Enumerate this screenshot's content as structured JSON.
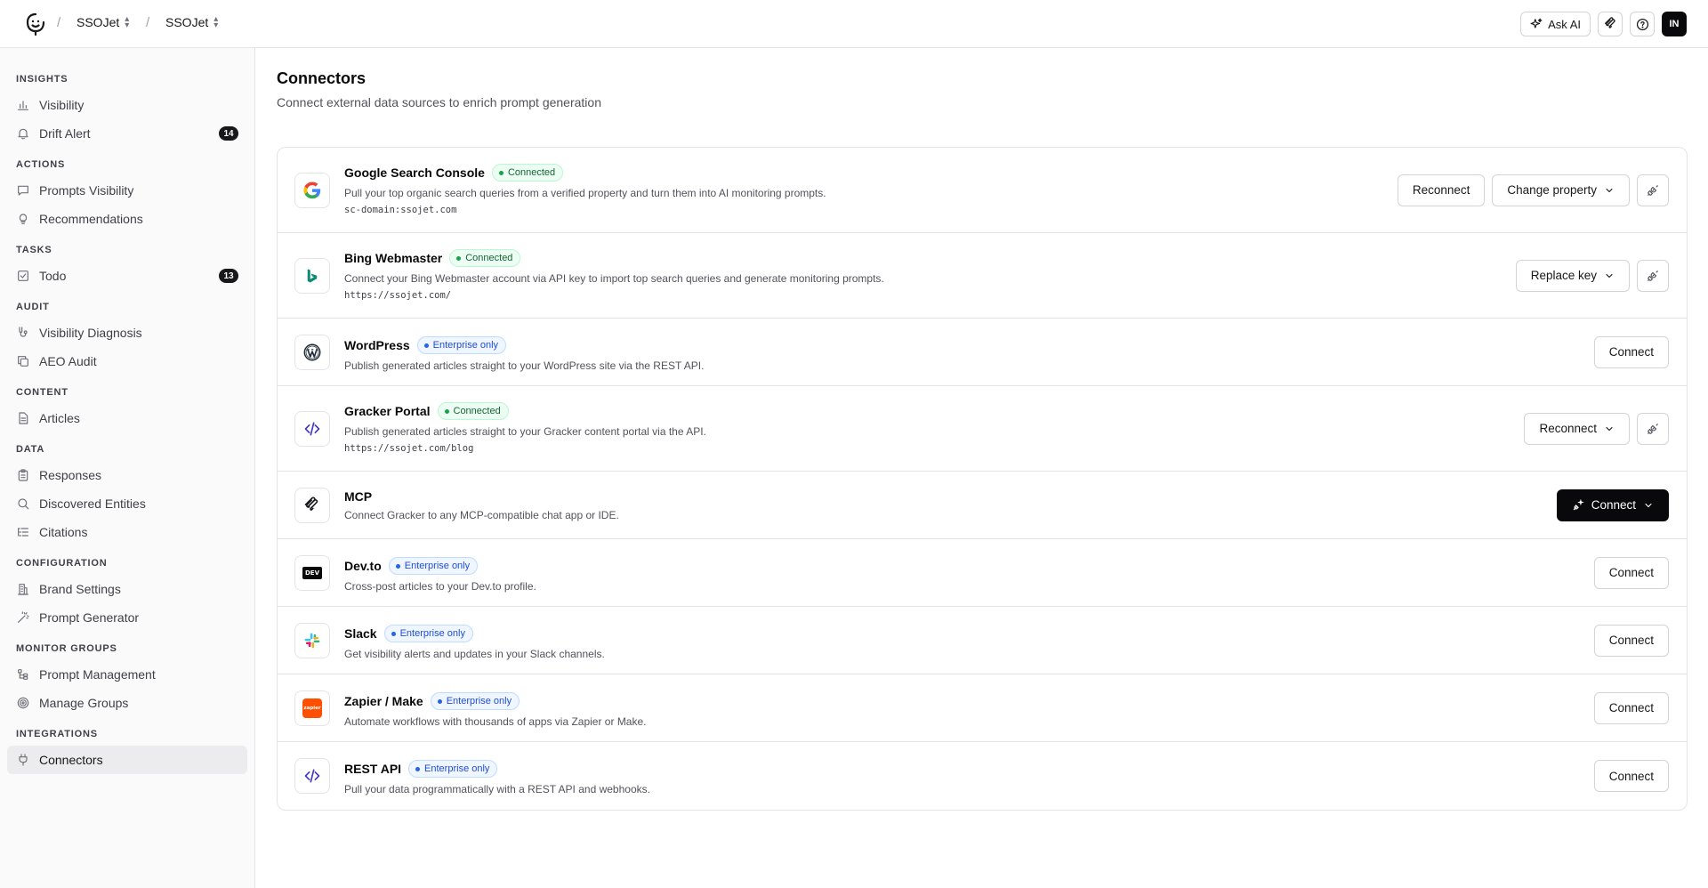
{
  "topbar": {
    "org": "SSOJet",
    "project": "SSOJet",
    "ask_ai": "Ask AI",
    "avatar_initials": "IN"
  },
  "sidebar": {
    "sections": [
      {
        "title": "INSIGHTS",
        "items": [
          {
            "label": "Visibility",
            "icon": "bar-chart-icon"
          },
          {
            "label": "Drift Alert",
            "icon": "bell-icon",
            "badge": "14"
          }
        ]
      },
      {
        "title": "ACTIONS",
        "items": [
          {
            "label": "Prompts Visibility",
            "icon": "message-icon"
          },
          {
            "label": "Recommendations",
            "icon": "lightbulb-icon"
          }
        ]
      },
      {
        "title": "TASKS",
        "items": [
          {
            "label": "Todo",
            "icon": "checkbox-icon",
            "badge": "13"
          }
        ]
      },
      {
        "title": "AUDIT",
        "items": [
          {
            "label": "Visibility Diagnosis",
            "icon": "stethoscope-icon"
          },
          {
            "label": "AEO Audit",
            "icon": "copy-icon"
          }
        ]
      },
      {
        "title": "CONTENT",
        "items": [
          {
            "label": "Articles",
            "icon": "file-icon"
          }
        ]
      },
      {
        "title": "DATA",
        "items": [
          {
            "label": "Responses",
            "icon": "clipboard-icon"
          },
          {
            "label": "Discovered Entities",
            "icon": "search-icon"
          },
          {
            "label": "Citations",
            "icon": "list-icon"
          }
        ]
      },
      {
        "title": "CONFIGURATION",
        "items": [
          {
            "label": "Brand Settings",
            "icon": "building-icon"
          },
          {
            "label": "Prompt Generator",
            "icon": "wand-icon"
          }
        ]
      },
      {
        "title": "MONITOR GROUPS",
        "items": [
          {
            "label": "Prompt Management",
            "icon": "tree-icon"
          },
          {
            "label": "Manage Groups",
            "icon": "target-icon"
          }
        ]
      },
      {
        "title": "INTEGRATIONS",
        "items": [
          {
            "label": "Connectors",
            "icon": "plug-icon",
            "active": true
          }
        ]
      }
    ]
  },
  "page": {
    "title": "Connectors",
    "subtitle": "Connect external data sources to enrich prompt generation"
  },
  "connectors": [
    {
      "name": "Google Search Console",
      "status": "Connected",
      "status_type": "connected",
      "description": "Pull your top organic search queries from a verified property and turn them into AI monitoring prompts.",
      "meta": "sc-domain:ssojet.com",
      "icon": "google-icon",
      "buttons": [
        {
          "label": "Reconnect",
          "style": "plain"
        },
        {
          "label": "Change property",
          "style": "dropdown"
        },
        {
          "label": "",
          "style": "unplug"
        }
      ]
    },
    {
      "name": "Bing Webmaster",
      "status": "Connected",
      "status_type": "connected",
      "description": "Connect your Bing Webmaster account via API key to import top search queries and generate monitoring prompts.",
      "meta": "https://ssojet.com/",
      "icon": "bing-icon",
      "buttons": [
        {
          "label": "Replace key",
          "style": "dropdown"
        },
        {
          "label": "",
          "style": "unplug"
        }
      ]
    },
    {
      "name": "WordPress",
      "status": "Enterprise only",
      "status_type": "enterprise",
      "description": "Publish generated articles straight to your WordPress site via the REST API.",
      "meta": "",
      "icon": "wordpress-icon",
      "buttons": [
        {
          "label": "Connect",
          "style": "plain"
        }
      ]
    },
    {
      "name": "Gracker Portal",
      "status": "Connected",
      "status_type": "connected",
      "description": "Publish generated articles straight to your Gracker content portal via the API.",
      "meta": "https://ssojet.com/blog",
      "icon": "code-icon",
      "buttons": [
        {
          "label": "Reconnect",
          "style": "dropdown"
        },
        {
          "label": "",
          "style": "unplug"
        }
      ]
    },
    {
      "name": "MCP",
      "status": "",
      "status_type": "",
      "description": "Connect Gracker to any MCP-compatible chat app or IDE.",
      "meta": "",
      "icon": "mcp-icon",
      "buttons": [
        {
          "label": "Connect",
          "style": "dark"
        }
      ]
    },
    {
      "name": "Dev.to",
      "status": "Enterprise only",
      "status_type": "enterprise",
      "description": "Cross-post articles to your Dev.to profile.",
      "meta": "",
      "icon": "devto-icon",
      "icon_text": "DEV",
      "buttons": [
        {
          "label": "Connect",
          "style": "plain"
        }
      ]
    },
    {
      "name": "Slack",
      "status": "Enterprise only",
      "status_type": "enterprise",
      "description": "Get visibility alerts and updates in your Slack channels.",
      "meta": "",
      "icon": "slack-icon",
      "buttons": [
        {
          "label": "Connect",
          "style": "plain"
        }
      ]
    },
    {
      "name": "Zapier / Make",
      "status": "Enterprise only",
      "status_type": "enterprise",
      "description": "Automate workflows with thousands of apps via Zapier or Make.",
      "meta": "",
      "icon": "zapier-icon",
      "icon_text": "zapier",
      "buttons": [
        {
          "label": "Connect",
          "style": "plain"
        }
      ]
    },
    {
      "name": "REST API",
      "status": "Enterprise only",
      "status_type": "enterprise",
      "description": "Pull your data programmatically with a REST API and webhooks.",
      "meta": "",
      "icon": "api-icon",
      "buttons": [
        {
          "label": "Connect",
          "style": "plain"
        }
      ]
    }
  ],
  "colors": {
    "connected_green": "#16a34a",
    "enterprise_blue": "#2563eb",
    "primary_dark": "#09090b",
    "zapier_orange": "#ff4f00"
  }
}
